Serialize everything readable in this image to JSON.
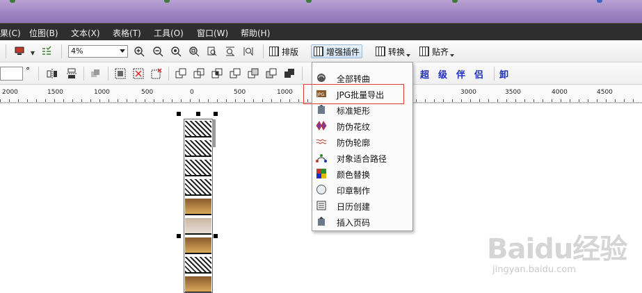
{
  "menubar": {
    "items": [
      "果(C)",
      "位图(B)",
      "文本(X)",
      "表格(T)",
      "工具(O)",
      "窗口(W)",
      "帮助(H)"
    ]
  },
  "toolbar": {
    "zoom_value": "4%",
    "buttons": [
      "排版",
      "增强插件",
      "转换",
      "贴齐"
    ]
  },
  "toolbar2": {
    "degree_symbol": "°",
    "blue_glyphs": [
      "超",
      "级",
      "伴",
      "侣",
      "卸"
    ]
  },
  "ruler": {
    "labels": [
      "2000",
      "1500",
      "1000",
      "500",
      "0",
      "500",
      "1000",
      "3000",
      "3500",
      "4000",
      "4500"
    ]
  },
  "dropdown": {
    "items": [
      {
        "label": "全部转曲",
        "icon": "curve-convert-icon"
      },
      {
        "label": "JPG批量导出",
        "icon": "jpg-export-icon"
      },
      {
        "label": "标准矩形",
        "icon": "rectangle-icon"
      },
      {
        "label": "防伪花纹",
        "icon": "pattern-icon"
      },
      {
        "label": "防伪轮廓",
        "icon": "outline-icon"
      },
      {
        "label": "对象适合路径",
        "icon": "path-fit-icon"
      },
      {
        "label": "颜色替换",
        "icon": "color-replace-icon"
      },
      {
        "label": "印章制作",
        "icon": "stamp-icon"
      },
      {
        "label": "日历创建",
        "icon": "calendar-icon"
      },
      {
        "label": "插入页码",
        "icon": "page-number-icon"
      }
    ],
    "highlighted_index": 1,
    "highlight_color": "#e03a3a"
  },
  "watermark": {
    "brand": "Baidu经验",
    "url": "jingyan.baidu.com"
  },
  "colors": {
    "menubar_bg": "#2e2e2e",
    "titlebar_bg": "#9f85c2",
    "active_button": "#cfe1f4",
    "accent_blue": "#1a2ec4"
  }
}
